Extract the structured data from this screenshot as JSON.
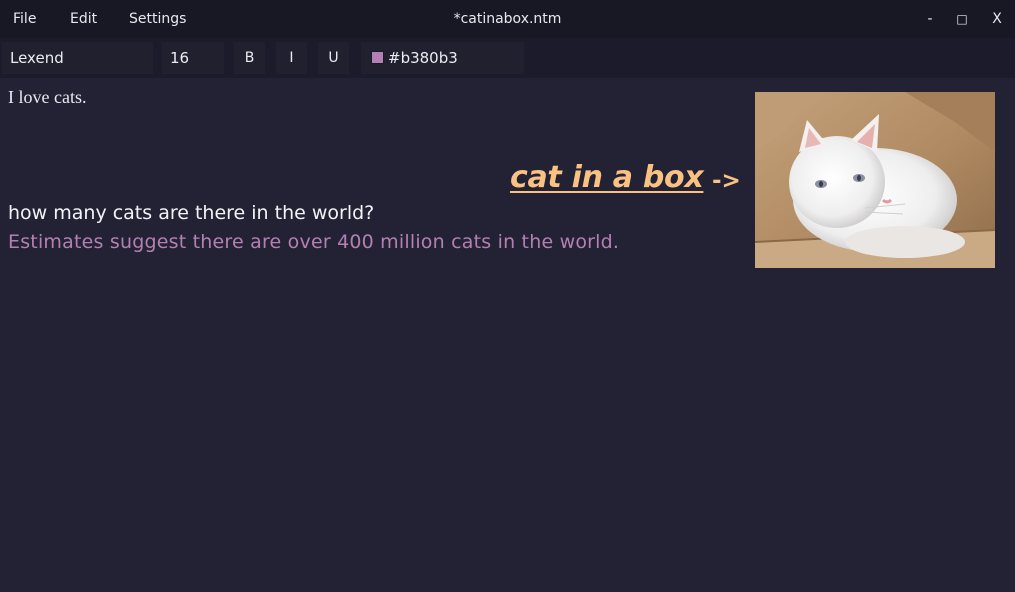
{
  "menu": {
    "file": "File",
    "edit": "Edit",
    "settings": "Settings"
  },
  "window": {
    "title": "*catinabox.ntm",
    "minimize": "-",
    "maximize": "□",
    "close": "X"
  },
  "toolbar": {
    "font": "Lexend",
    "size": "16",
    "bold": "B",
    "italic": "I",
    "underline": "U",
    "color_value": "#b380b3"
  },
  "document": {
    "line1": "I love cats.",
    "heading": "cat in a box",
    "arrow": "->",
    "question": "how many cats are there in the world?",
    "answer": "Estimates suggest there are over 400 million cats in the world.",
    "image_icon": "cat-in-box-photo"
  },
  "colors": {
    "background": "#232234",
    "titlebar": "#181825",
    "heading": "#f9c283",
    "answer": "#b380b3",
    "text": "#f3f3f6"
  }
}
